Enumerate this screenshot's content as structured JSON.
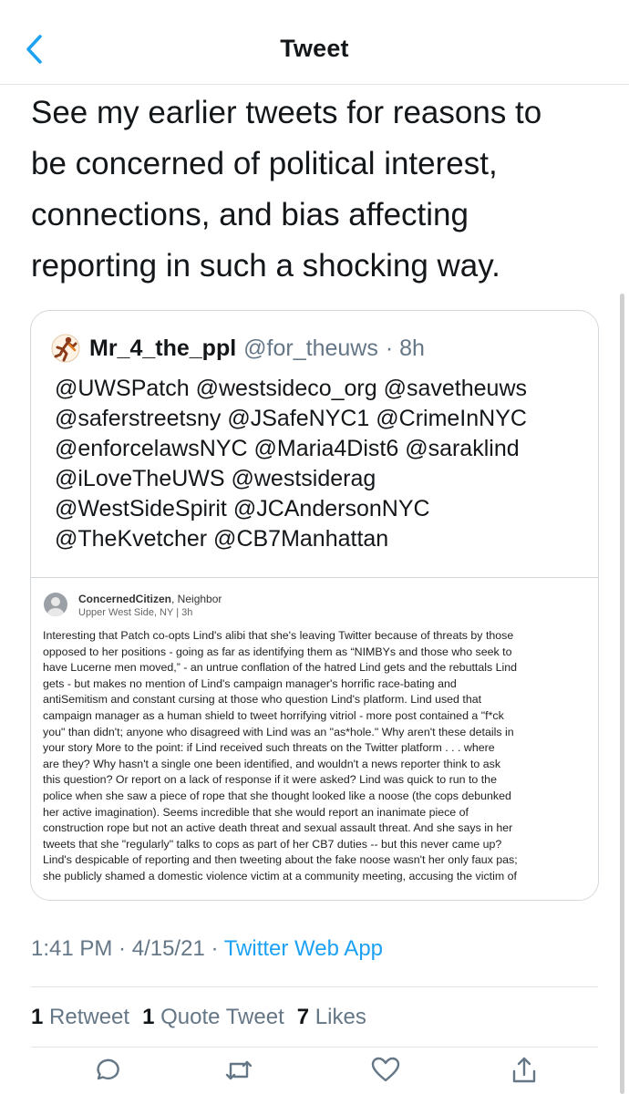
{
  "header": {
    "title": "Tweet",
    "back_icon": "chevron-left-icon",
    "accent": "#1da1f2"
  },
  "tweet": {
    "text_lines": [
      "See my earlier tweets for reasons to",
      "be concerned of political interest,",
      "connections, and bias affecting",
      "reporting in such a shocking way."
    ]
  },
  "quoted": {
    "name": "Mr_4_the_ppl",
    "handle": "@for_theuws",
    "time": "· 8h",
    "avatar_icon": "running-figure-avatar-icon",
    "text_lines": [
      "@UWSPatch @westsideco_org @savetheuws",
      "@saferstreetsny @JSafeNYC1 @CrimeInNYC",
      "@enforcelawsNYC @Maria4Dist6 @saraklind",
      "@iLoveTheUWS @westsiderag",
      "@WestSideSpirit @JCAndersonNYC",
      "@TheKvetcher @CB7Manhattan"
    ],
    "embed": {
      "author": "ConcernedCitizen",
      "author_role": ", Neighbor",
      "location": "Upper West Side, NY | 3h",
      "body_lines": [
        "Interesting that Patch co-opts Lind's alibi that she's leaving Twitter because of threats by those",
        "opposed to her positions - going as far as identifying them as “NIMBYs and those who seek to",
        "have Lucerne men moved,” - an untrue conflation of the hatred Lind gets and the rebuttals Lind",
        "gets - but makes no mention of Lind's campaign manager's horrific race-bating and",
        "antiSemitism and constant cursing at those who question Lind's platform. Lind used that",
        "campaign manager as a human shield to tweet horrifying vitriol - more post contained a \"f*ck",
        "you\" than didn't; anyone who disagreed with Lind was an \"as*hole.\" Why aren't these details in",
        "your story More to the point: if Lind received such threats on the Twitter platform . . . where",
        "are they? Why hasn't a single one been identified, and wouldn't a news reporter think to ask",
        "this question? Or report on a lack of response if it were asked? Lind was quick to run to the",
        "police when she saw a piece of rope that she thought looked like a noose (the cops debunked",
        "her active imagination). Seems incredible that she would report an inanimate piece of",
        "construction rope but not an active death threat and sexual assault threat. And she says in her",
        "tweets that she \"regularly\" talks to cops as part of her CB7 duties -- but this never came up?",
        "Lind's despicable of reporting and then tweeting about the fake noose wasn't her only faux pas;",
        "she publicly shamed a domestic violence victim at a community meeting, accusing the victim of"
      ]
    }
  },
  "meta": {
    "time": "1:41 PM",
    "separator1": " · ",
    "date": "4/15/21",
    "separator2": " · ",
    "source": "Twitter Web App"
  },
  "stats": {
    "retweets_count": "1",
    "retweets_label": "Retweet",
    "quotes_count": "1",
    "quotes_label": "Quote Tweet",
    "likes_count": "7",
    "likes_label": "Likes"
  },
  "actions": {
    "reply_icon": "reply-icon",
    "retweet_icon": "retweet-icon",
    "like_icon": "heart-icon",
    "share_icon": "share-icon",
    "icon_color": "#657786"
  }
}
